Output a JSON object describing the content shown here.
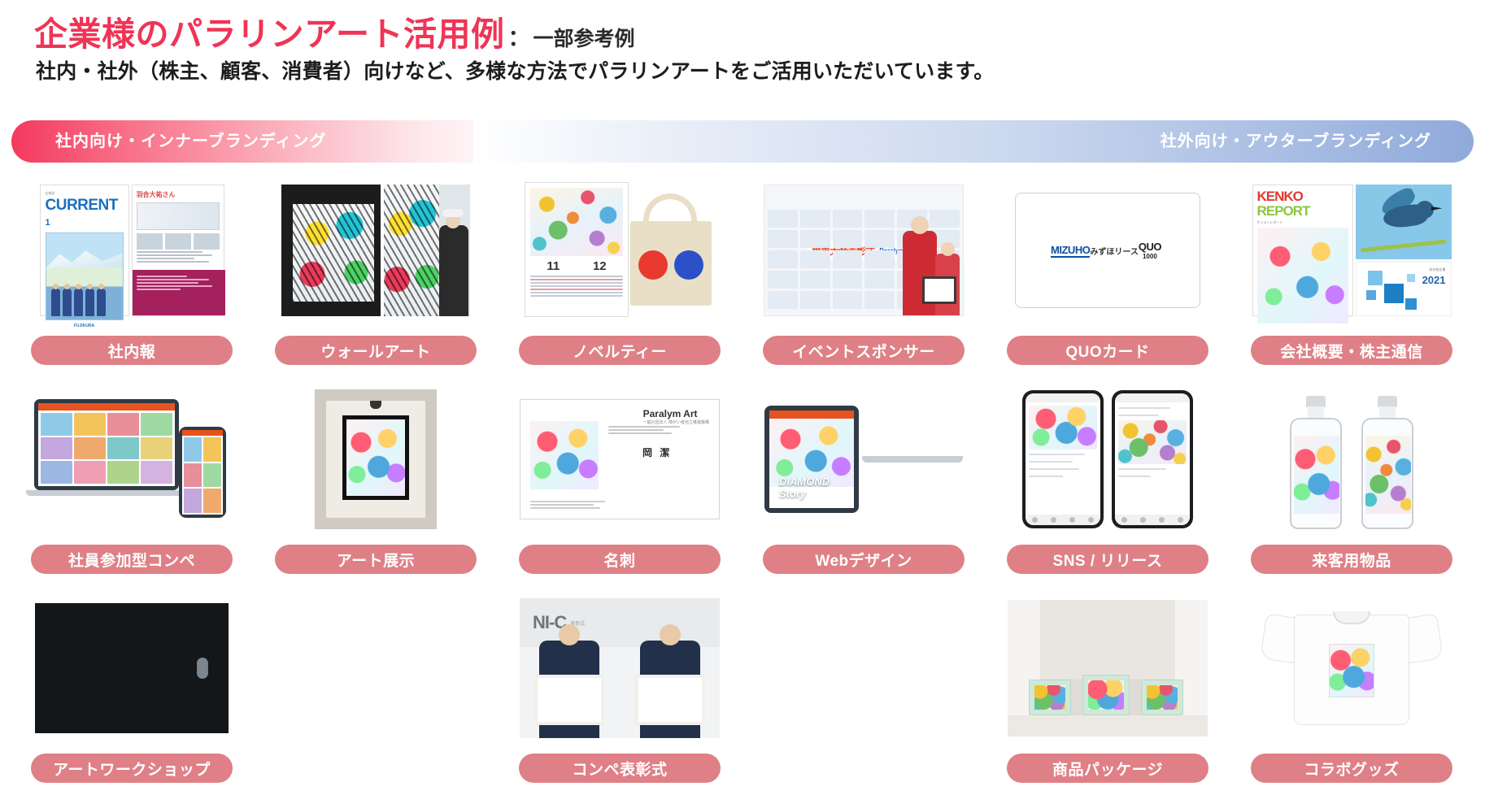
{
  "header": {
    "title_main": "企業様のパラリンアート活用例",
    "title_colon": "：",
    "title_sub": "一部参考例",
    "subtitle": "社内・社外（株主、顧客、消費者）向けなど、多様な方法でパラリンアートをご活用いただいています。"
  },
  "banner": {
    "left_label": "社内向け・インナーブランディング",
    "right_label": "社外向け・アウターブランディング",
    "left_color_start": "#f4395e",
    "right_color_end": "#8fa9da"
  },
  "colors": {
    "title_red": "#ef3456",
    "pill": "#df8086",
    "pill_text": "#ffffff",
    "text_dark": "#1d1d1f"
  },
  "cells": [
    {
      "id": "shanaiho",
      "label": "社内報",
      "thumb": "newsletter",
      "visible": true
    },
    {
      "id": "wall-art",
      "label": "ウォールアート",
      "thumb": "wallart",
      "visible": true
    },
    {
      "id": "novelty",
      "label": "ノベルティー",
      "thumb": "novelty",
      "visible": true
    },
    {
      "id": "event-sponsor",
      "label": "イベントスポンサー",
      "thumb": "event",
      "visible": true
    },
    {
      "id": "quo-card",
      "label": "QUOカード",
      "thumb": "quocard",
      "visible": true
    },
    {
      "id": "company-profile",
      "label": "会社概要・株主通信",
      "thumb": "kenko",
      "visible": true
    },
    {
      "id": "employee-compe",
      "label": "社員参加型コンペ",
      "thumb": "devices",
      "visible": true
    },
    {
      "id": "art-exhibition",
      "label": "アート展示",
      "thumb": "exhibition",
      "visible": true
    },
    {
      "id": "business-card",
      "label": "名刺",
      "thumb": "businesscard",
      "visible": true
    },
    {
      "id": "web-design",
      "label": "Webデザイン",
      "thumb": "webdesign",
      "visible": true
    },
    {
      "id": "sns-release",
      "label": "SNS / リリース",
      "thumb": "sns",
      "visible": true
    },
    {
      "id": "visitor-goods",
      "label": "来客用物品",
      "thumb": "bottles",
      "visible": true
    },
    {
      "id": "art-workshop",
      "label": "アートワークショップ",
      "thumb": "videocall",
      "visible": true
    },
    {
      "id": "blank-1",
      "label": "",
      "thumb": "",
      "visible": false
    },
    {
      "id": "award-ceremony",
      "label": "コンペ表彰式",
      "thumb": "award",
      "visible": true
    },
    {
      "id": "blank-2",
      "label": "",
      "thumb": "",
      "visible": false
    },
    {
      "id": "product-package",
      "label": "商品パッケージ",
      "thumb": "package",
      "visible": true
    },
    {
      "id": "collab-goods",
      "label": "コラボグッズ",
      "thumb": "tshirt",
      "visible": true
    }
  ],
  "thumb_text": {
    "newsletter_title": "CURRENT",
    "newsletter_issue": "1",
    "newsletter_brand": "広報誌",
    "newsletter_logo": "FUJIKURA",
    "newsletter_headline": "羽合大祐さん",
    "calendar_month_a": "11",
    "calendar_month_b": "12",
    "event_title_jp": "世界大会表彰式",
    "event_title_en": "Paralym Art",
    "quo_mizuho": "MIZUHO",
    "quo_lease": "みずほリース",
    "quo_brand": "QUO",
    "quo_value": "1000",
    "kenko_k1": "KENKO",
    "kenko_k2": "REPORT",
    "kenko_sub": "ケンコーレポート",
    "kenko_year": "2021",
    "card_company": "Paralym Art",
    "card_company_sub": "一般社団法人 障がい者自立推進機構",
    "card_name": "岡 潔",
    "web_title": "DIAMOND Story",
    "award_backdrop": "NI-C"
  }
}
